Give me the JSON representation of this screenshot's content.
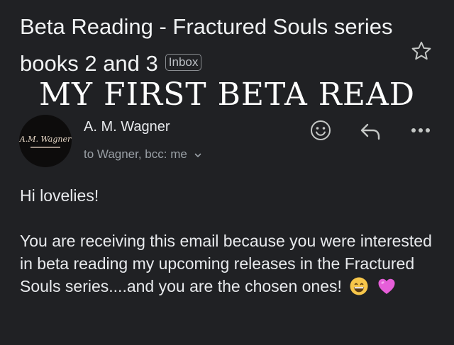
{
  "email": {
    "subject": "Beta Reading - Fractured Souls series books 2 and 3",
    "label": "Inbox",
    "banner": "MY FIRST BETA READ",
    "sender": {
      "name": "A. M. Wagner",
      "avatar_text": "A.M. Wagner"
    },
    "recipients": "to Wagner, bcc: me",
    "greeting": "Hi lovelies!",
    "body": "You are receiving this email because you were interested in beta reading my upcoming releases in the Fractured Souls series....and you are the chosen ones!",
    "body_emojis": [
      "grinning-face-emoji",
      "pink-heart-emoji"
    ]
  },
  "icons": {
    "star": "star-icon",
    "add_emoji": "emoji-icon",
    "reply": "reply-icon",
    "more": "more-icon"
  },
  "colors": {
    "background": "#202124",
    "text_primary": "#e8eaed",
    "text_secondary": "#9aa0a6",
    "heart": "#e65ed9",
    "emoji_face": "#f7c64a"
  }
}
